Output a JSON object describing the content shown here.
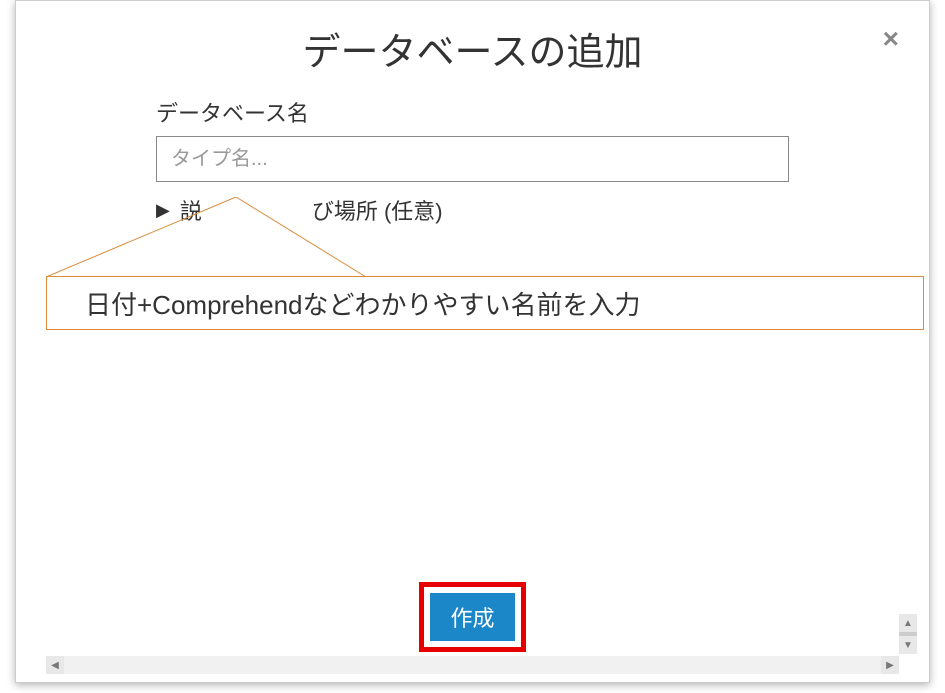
{
  "modal": {
    "title": "データベースの追加",
    "close_icon": "×"
  },
  "form": {
    "database_name_label": "データベース名",
    "database_name_placeholder": "タイプ名...",
    "database_name_value": "",
    "collapse_prefix": "説",
    "collapse_suffix": "び場所 (任意)",
    "caret": "▶"
  },
  "annotation": {
    "text": "日付+Comprehendなどわかりやすい名前を入力"
  },
  "footer": {
    "create_label": "作成"
  },
  "scroll": {
    "left_arrow": "◀",
    "right_arrow": "▶",
    "up_arrow": "▲",
    "down_arrow": "▼"
  }
}
